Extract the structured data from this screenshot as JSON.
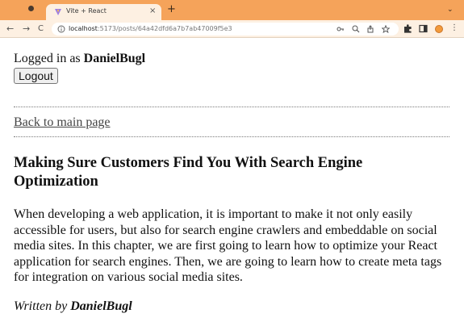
{
  "browser": {
    "tab_title": "Vite + React",
    "tab_close": "×",
    "new_tab": "+",
    "tab_menu": "⌄",
    "url_host": "localhost",
    "url_path": ":5173/posts/64a42dfd6a7b7ab47009f5e3",
    "back": "←",
    "forward": "→",
    "reload": "C",
    "menu": "⋮"
  },
  "page": {
    "login_prefix": "Logged in as ",
    "username": "DanielBugl",
    "logout_label": "Logout",
    "back_link": "Back to main page",
    "post_title": "Making Sure Customers Find You With Search Engine Optimization",
    "post_body": "When developing a web application, it is important to make it not only easily accessible for users, but also for search engine crawlers and embeddable on social media sites. In this chapter, we are first going to learn how to optimize your React application for search engines. Then, we are going to learn how to create meta tags for integration on various social media sites.",
    "byline_prefix": "Written by ",
    "author": "DanielBugl"
  },
  "colors": {
    "tabstrip": "#f5a35a",
    "toolbar": "#fdf0e2",
    "profile": "#f39a3b"
  }
}
